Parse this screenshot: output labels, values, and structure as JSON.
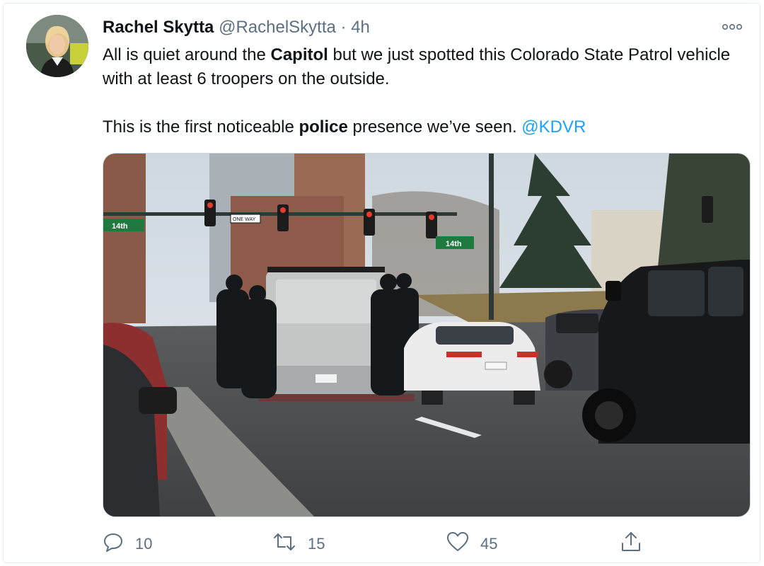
{
  "tweet": {
    "author_name": "Rachel Skytta",
    "handle": "@RachelSkytta",
    "separator": "·",
    "time": "4h",
    "text": {
      "p1_a": "All is quiet around the ",
      "p1_bold": "Capitol",
      "p1_b": " but we just spotted this Colorado State Patrol vehicle with at least 6 troopers on the outside.",
      "p2_a": "This is the first noticeable ",
      "p2_bold": "police",
      "p2_b": " presence we’ve seen. ",
      "mention": "@KDVR"
    },
    "media": {
      "street_sign_left": "14th",
      "street_sign_right": "14th",
      "one_way": "ONE WAY"
    },
    "actions": {
      "reply_count": "10",
      "retweet_count": "15",
      "like_count": "45"
    }
  },
  "icons": {
    "more": "more-horizontal-icon",
    "reply": "reply-icon",
    "retweet": "retweet-icon",
    "like": "heart-icon",
    "share": "share-icon"
  },
  "colors": {
    "text_primary": "#0f1419",
    "text_secondary": "#5b7083",
    "link": "#1da1f2",
    "border": "#e6ecf0"
  }
}
